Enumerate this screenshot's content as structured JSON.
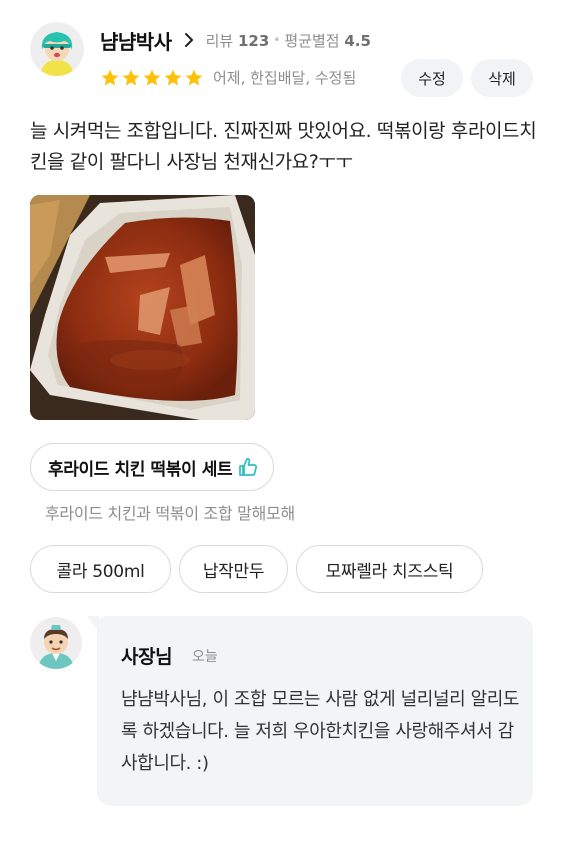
{
  "review": {
    "user": {
      "name": "냠냠박사",
      "review_label": "리뷰",
      "review_count": "123",
      "avg_label": "평균별점",
      "avg_rating": "4.5"
    },
    "rating": 5,
    "rating_max": 5,
    "info": "어제, 한집배달, 수정됨",
    "edit_label": "수정",
    "delete_label": "삭제",
    "text": "늘 시켜먹는 조합입니다. 진짜진짜 맛있어요. 떡볶이랑 후라이드치킨을 같이 팔다니 사장님 천재신가요?ㅜㅜ",
    "menu": {
      "name": "후라이드 치킨 떡볶이 세트",
      "description": "후라이드 치킨과 떡볶이 조합 말해모해"
    },
    "options": [
      "콜라 500ml",
      "납작만두",
      "모짜렐라 치즈스틱"
    ]
  },
  "reply": {
    "author": "사장님",
    "time": "오늘",
    "text": "냠냠박사님, 이 조합 모르는 사람 없게 널리널리 알리도록 하겠습니다. 늘 저희 우아한치킨을 사랑해주셔서 감사합니다. :)"
  },
  "colors": {
    "star": "#FFC107",
    "chip_bg": "#F2F3F5",
    "bubble_bg": "#F3F4F6",
    "thumb": "#2AC1BC",
    "muted_text": "#8E8E8E"
  },
  "icons": {
    "chevron": "chevron-right-icon",
    "star": "star-icon",
    "thumb": "thumbs-up-icon"
  }
}
